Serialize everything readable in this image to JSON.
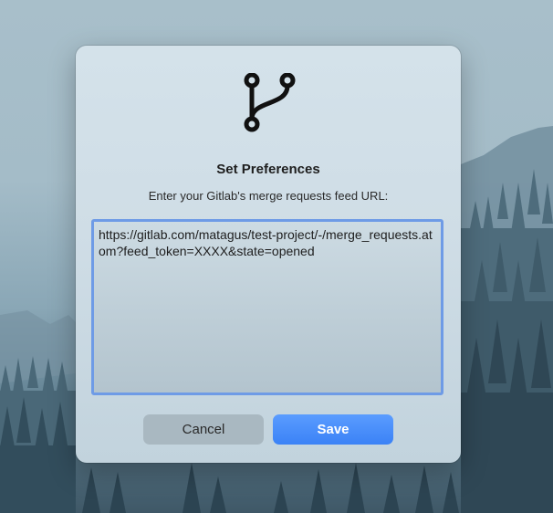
{
  "dialog": {
    "app_icon": "git-branch-icon",
    "title": "Set Preferences",
    "subtitle": "Enter your Gitlab's merge requests feed URL:",
    "feed_url_value": "https://gitlab.com/matagus/test-project/-/merge_requests.atom?feed_token=XXXX&state=opened",
    "cancel_label": "Cancel",
    "save_label": "Save"
  },
  "colors": {
    "accent": "#3b82f6",
    "focus_ring": "#6e9be6"
  }
}
